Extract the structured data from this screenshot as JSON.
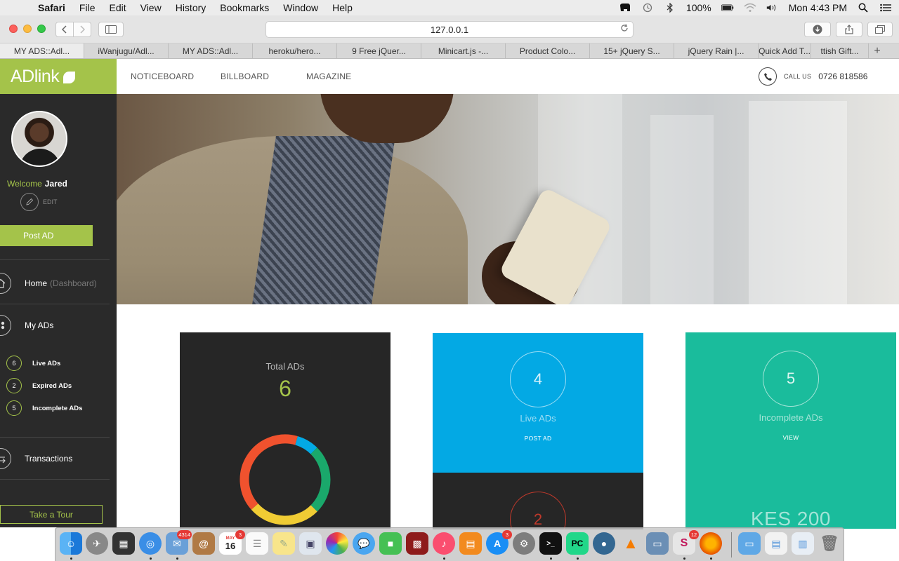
{
  "menubar": {
    "app": "Safari",
    "items": [
      "File",
      "Edit",
      "View",
      "History",
      "Bookmarks",
      "Window",
      "Help"
    ],
    "battery": "100%",
    "clock": "Mon 4:43 PM"
  },
  "browser": {
    "url": "127.0.0.1",
    "tabs": [
      "MY ADS::Adl...",
      "iWanjugu/Adl...",
      "MY ADS::Adl...",
      "heroku/hero...",
      "9 Free jQuer...",
      "Minicart.js -...",
      "Product Colo...",
      "15+ jQuery S...",
      "jQuery Rain |...",
      "Quick Add T...",
      "ttish Gift..."
    ],
    "new_tab": "+"
  },
  "sidebar": {
    "logo": "ADlink",
    "welcome_label": "Welcome",
    "user_name": "Jared",
    "edit_label": "EDIT",
    "post_ad_label": "Post AD",
    "nav": {
      "home": "Home",
      "home_sub": "(Dashboard)",
      "my_ads": "My ADs",
      "transactions": "Transactions"
    },
    "sub_items": [
      {
        "count": "6",
        "label": "Live ADs"
      },
      {
        "count": "2",
        "label": "Expired ADs"
      },
      {
        "count": "5",
        "label": "Incomplete ADs"
      }
    ],
    "tour_label": "Take a Tour"
  },
  "topnav": {
    "links": [
      "NOTICEBOARD",
      "BILLBOARD",
      "MAGAZINE"
    ],
    "call_label": "CALL US",
    "phone": "0726 818586"
  },
  "stats": {
    "total": {
      "title": "Total ADs",
      "value": "6"
    },
    "live": {
      "value": "4",
      "label": "Live ADs",
      "action": "POST AD"
    },
    "expired": {
      "value": "2"
    },
    "incomplete": {
      "value": "5",
      "label": "Incomplete ADs",
      "action": "VIEW",
      "amount": "KES 200"
    }
  },
  "chart_data": {
    "type": "pie",
    "style": "donut",
    "segments_colors": [
      "#03a9e4",
      "#1aa86b",
      "#f0cc34",
      "#f0522e"
    ],
    "values": [
      0.08,
      0.25,
      0.26,
      0.41
    ]
  },
  "dock": {
    "badges": {
      "mail": "4314",
      "calendar": "3",
      "appstore": "3",
      "slack": "12"
    },
    "calendar_day": "16",
    "calendar_month": "MAY"
  },
  "colors": {
    "accent_green": "#a4c34a",
    "blue": "#03a9e4",
    "teal": "#1abc9c",
    "dark": "#262626"
  }
}
